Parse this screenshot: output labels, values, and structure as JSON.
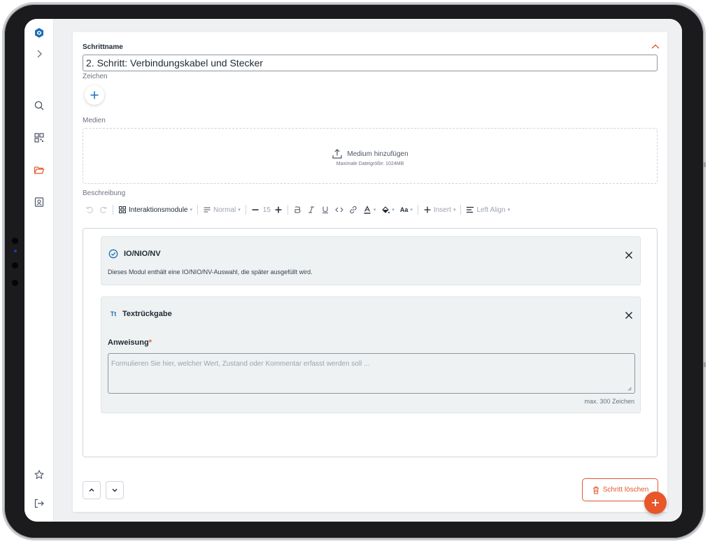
{
  "step": {
    "name_label": "Schrittname",
    "name_value": "2. Schritt: Verbindungskabel und Stecker",
    "signs_label": "Zeichen",
    "media_label": "Medien",
    "media_add": "Medium hinzufügen",
    "media_max": "Maximale Dateigröße: 1024MB",
    "description_label": "Beschreibung"
  },
  "toolbar": {
    "interaction_modules": "Interaktionsmodule",
    "block_style": "Normal",
    "font_size": "15",
    "insert": "Insert",
    "align": "Left Align",
    "font_case": "Aa"
  },
  "modules": [
    {
      "title": "IO/NIO/NV",
      "description": "Dieses Modul enthält eine IO/NIO/NV-Auswahl, die später ausgefüllt wird."
    },
    {
      "title": "Textrückgabe",
      "icon_text": "Tt",
      "field_label": "Anweisung",
      "required_mark": "*",
      "placeholder": "Formulieren Sie hier, welcher Wert, Zustand oder Kommentar erfasst werden soll ...",
      "max_hint": "max. 300 Zeichen"
    }
  ],
  "actions": {
    "delete_label": "Schritt löschen"
  },
  "colors": {
    "accent": "#e8562a",
    "brand": "#1f6fb5",
    "module_bg": "#eef2f3"
  },
  "icons": {
    "sidebar": [
      "logo-icon",
      "chevron-right-icon",
      "search-icon",
      "qr-code-icon",
      "folder-icon",
      "contact-card-icon",
      "star-icon",
      "logout-icon"
    ]
  }
}
